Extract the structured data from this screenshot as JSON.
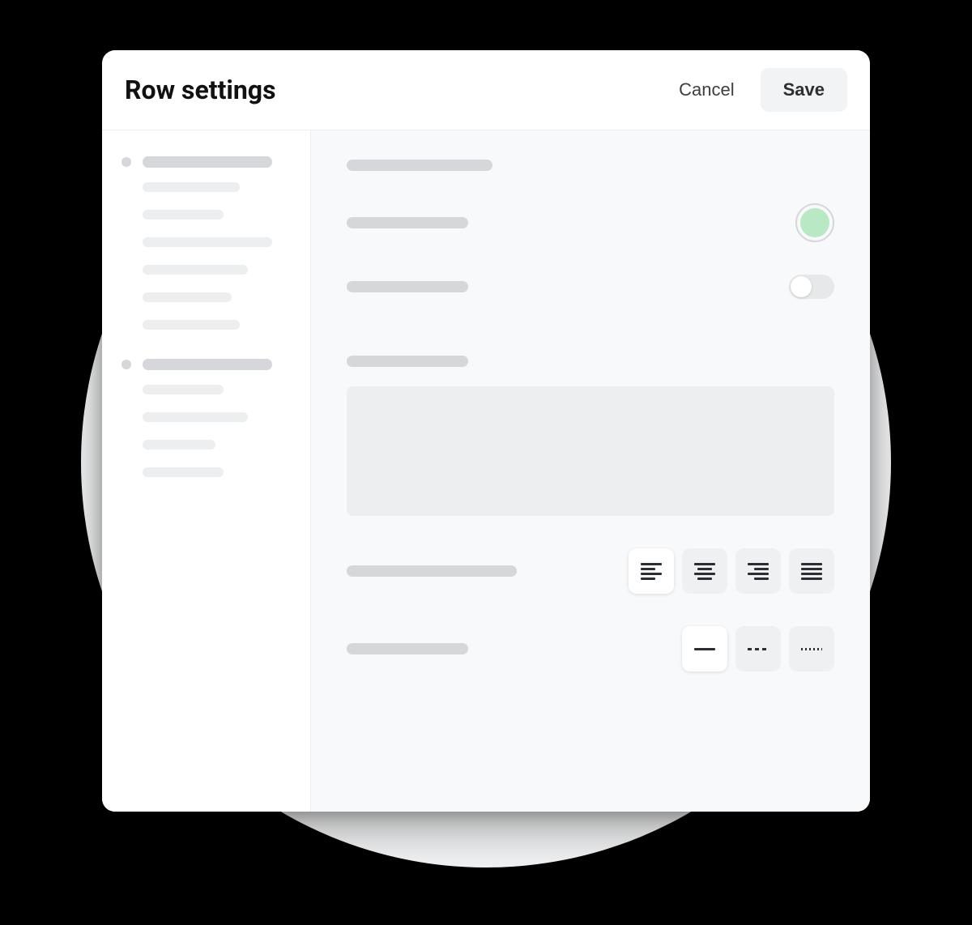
{
  "modal": {
    "title": "Row settings",
    "cancel_label": "Cancel",
    "save_label": "Save"
  },
  "sidebar": {
    "groups": [
      {
        "sub_count": 6
      },
      {
        "sub_count": 4
      }
    ]
  },
  "content": {
    "color_value": "#b8e8c4",
    "toggle_on": false,
    "align_options": [
      "left",
      "center",
      "right",
      "justify"
    ],
    "align_selected": "left",
    "border_options": [
      "solid",
      "dashed",
      "dotted"
    ],
    "border_selected": "solid"
  }
}
